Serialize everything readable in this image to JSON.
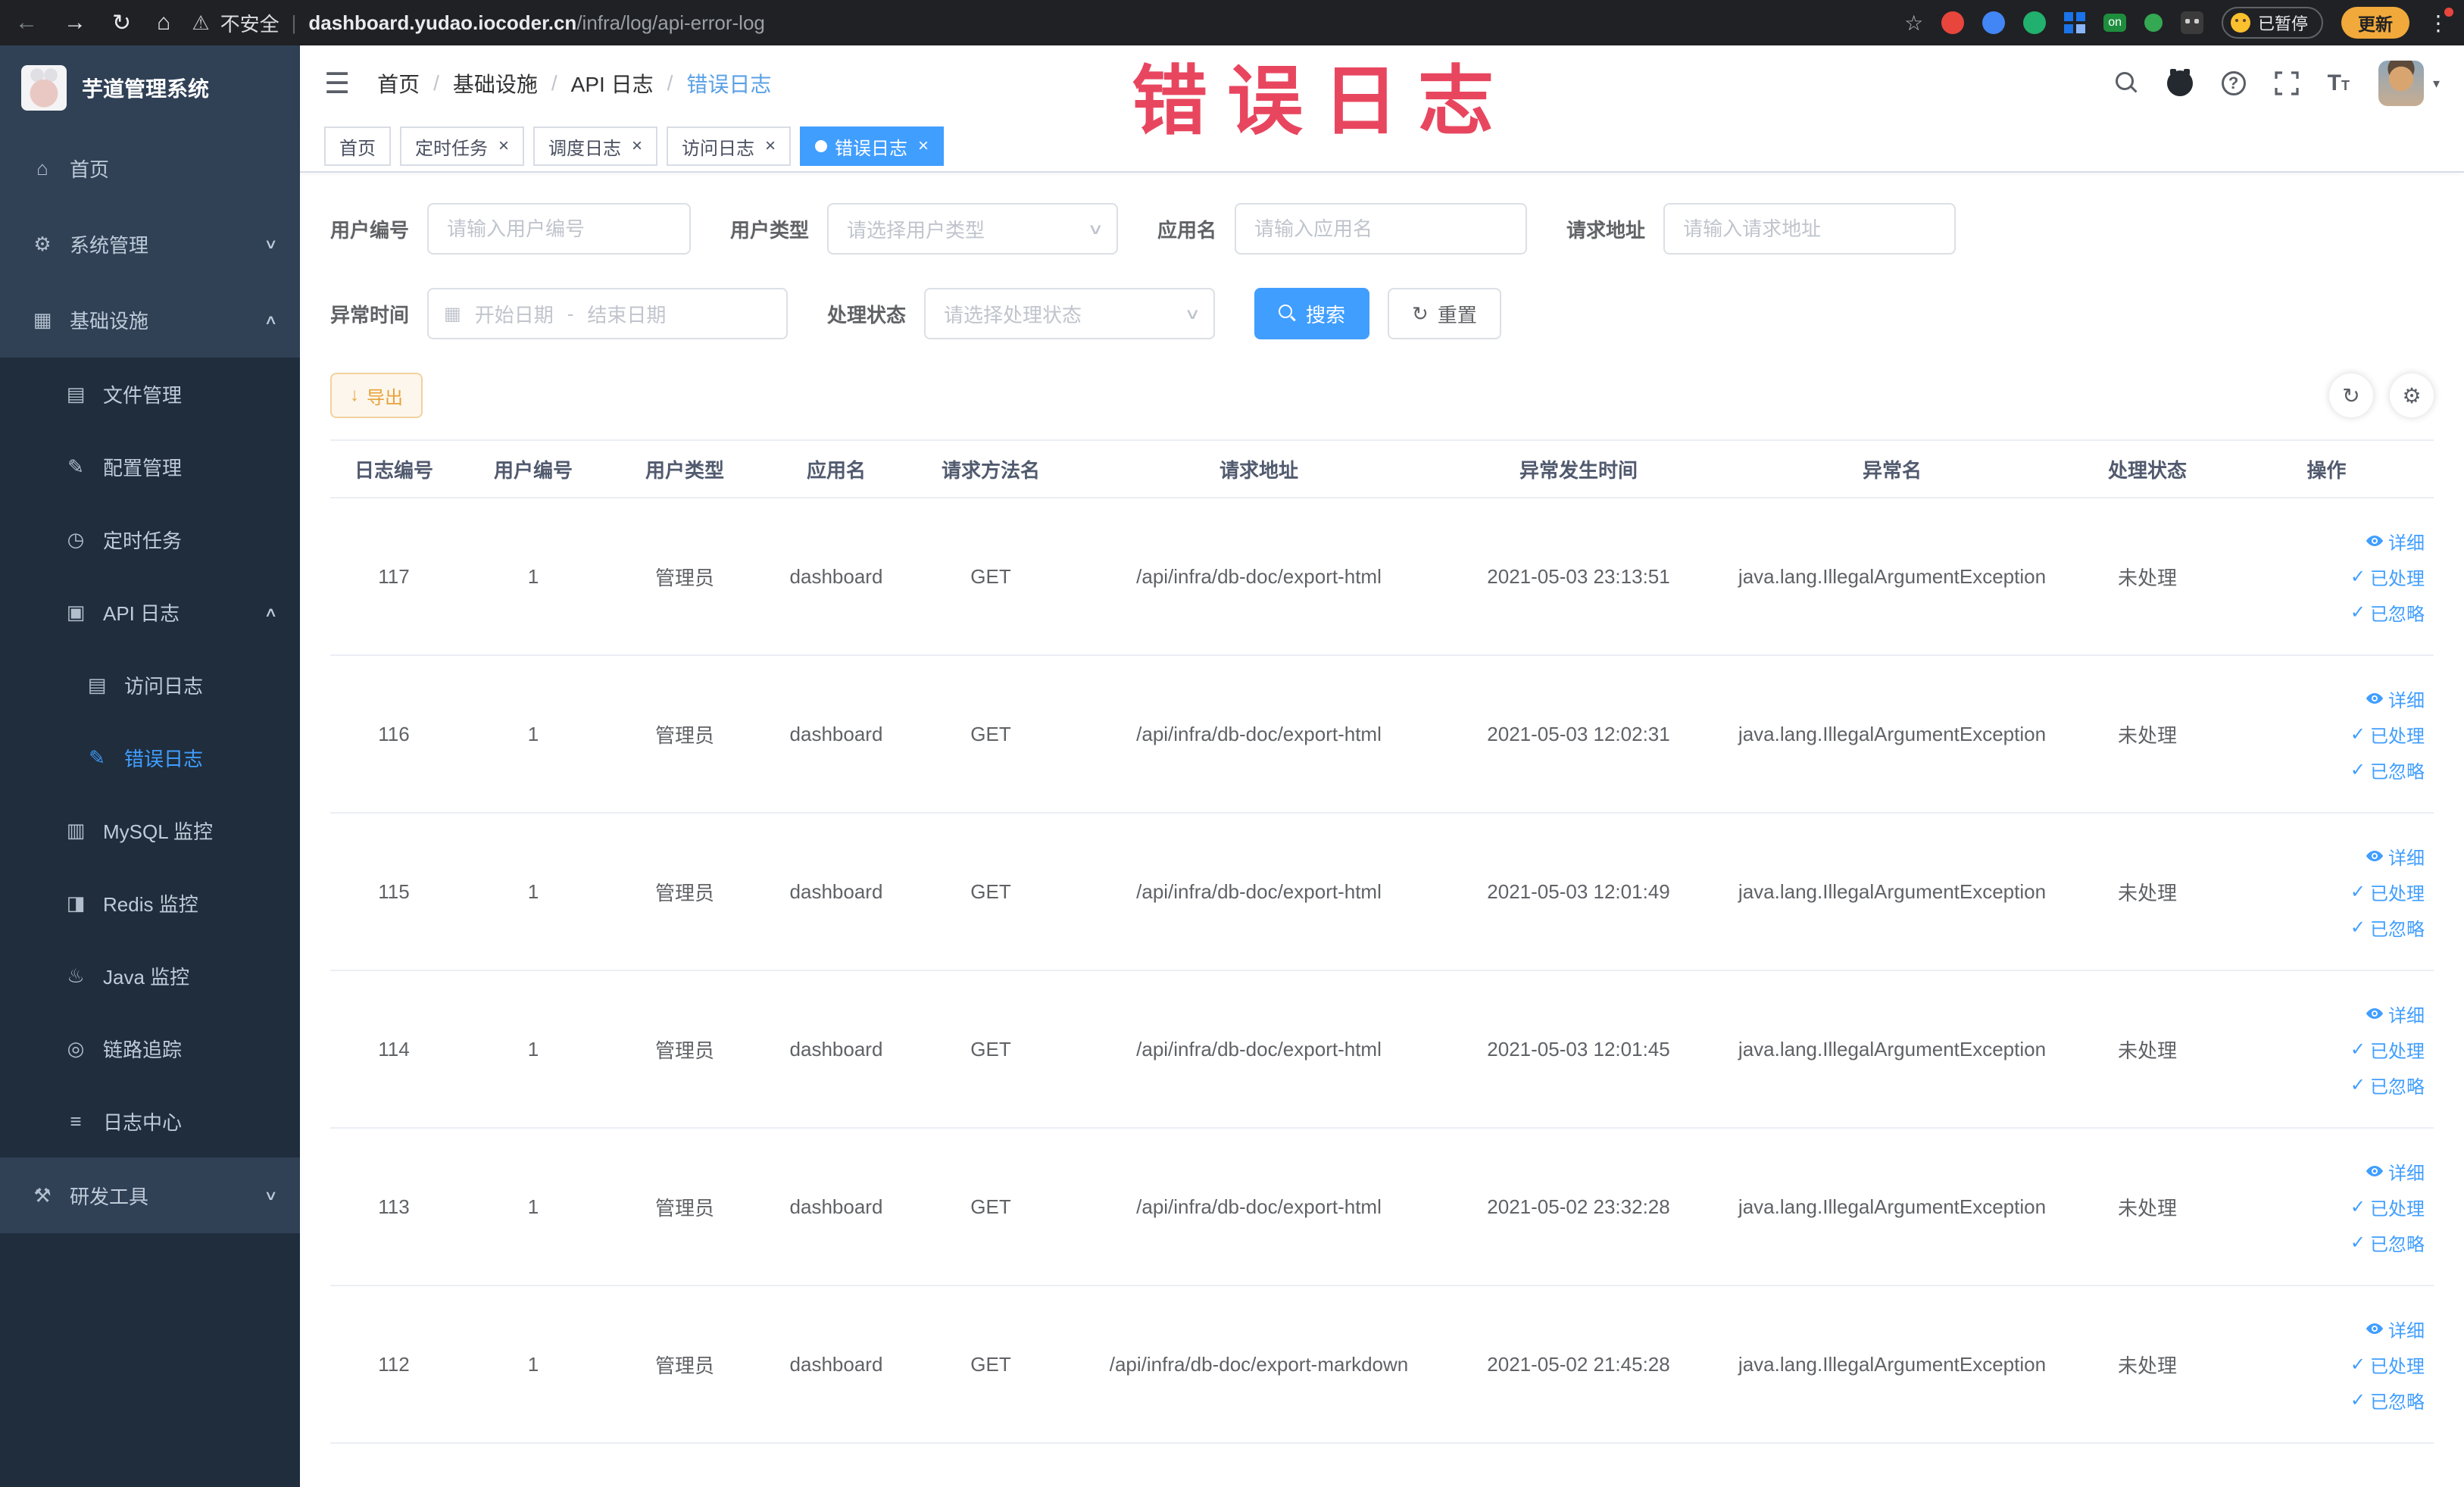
{
  "browser": {
    "security_warning": "不安全",
    "url_host": "dashboard.yudao.iocoder.cn",
    "url_path": "/infra/log/api-error-log",
    "on_badge": "on",
    "paused_badge": "已暂停",
    "update_button": "更新"
  },
  "watermark": "错误日志",
  "sidebar": {
    "logo_title": "芋道管理系统",
    "items": [
      {
        "label": "首页",
        "icon": "home-icon",
        "level": 0
      },
      {
        "label": "系统管理",
        "icon": "gear-icon",
        "level": 0,
        "arrow": "down"
      },
      {
        "label": "基础设施",
        "icon": "infra-icon",
        "level": 0,
        "arrow": "up"
      },
      {
        "label": "文件管理",
        "icon": "file-icon",
        "level": 1
      },
      {
        "label": "配置管理",
        "icon": "config-icon",
        "level": 1
      },
      {
        "label": "定时任务",
        "icon": "timer-icon",
        "level": 1
      },
      {
        "label": "API 日志",
        "icon": "api-log-icon",
        "level": 1,
        "arrow": "up"
      },
      {
        "label": "访问日志",
        "icon": "access-log-icon",
        "level": 2
      },
      {
        "label": "错误日志",
        "icon": "error-log-icon",
        "level": 2,
        "active": true
      },
      {
        "label": "MySQL 监控",
        "icon": "mysql-icon",
        "level": 1
      },
      {
        "label": "Redis 监控",
        "icon": "redis-icon",
        "level": 1
      },
      {
        "label": "Java 监控",
        "icon": "java-icon",
        "level": 1
      },
      {
        "label": "链路追踪",
        "icon": "trace-icon",
        "level": 1
      },
      {
        "label": "日志中心",
        "icon": "log-center-icon",
        "level": 1
      },
      {
        "label": "研发工具",
        "icon": "tools-icon",
        "level": 0,
        "arrow": "down"
      }
    ]
  },
  "breadcrumb": [
    "首页",
    "基础设施",
    "API 日志",
    "错误日志"
  ],
  "tabs": [
    {
      "label": "首页",
      "closable": false,
      "active": false
    },
    {
      "label": "定时任务",
      "closable": true,
      "active": false
    },
    {
      "label": "调度日志",
      "closable": true,
      "active": false
    },
    {
      "label": "访问日志",
      "closable": true,
      "active": false
    },
    {
      "label": "错误日志",
      "closable": true,
      "active": true
    }
  ],
  "search": {
    "fields": {
      "user_id": {
        "label": "用户编号",
        "placeholder": "请输入用户编号"
      },
      "user_type": {
        "label": "用户类型",
        "placeholder": "请选择用户类型"
      },
      "app_name": {
        "label": "应用名",
        "placeholder": "请输入应用名"
      },
      "request_url": {
        "label": "请求地址",
        "placeholder": "请输入请求地址"
      },
      "exception_time": {
        "label": "异常时间",
        "start_placeholder": "开始日期",
        "separator": "-",
        "end_placeholder": "结束日期"
      },
      "process_status": {
        "label": "处理状态",
        "placeholder": "请选择处理状态"
      }
    },
    "search_button": "搜索",
    "reset_button": "重置"
  },
  "toolbar": {
    "export_button": "导出"
  },
  "table": {
    "columns": [
      "日志编号",
      "用户编号",
      "用户类型",
      "应用名",
      "请求方法名",
      "请求地址",
      "异常发生时间",
      "异常名",
      "处理状态",
      "操作"
    ],
    "action_labels": [
      "详细",
      "已处理",
      "已忽略"
    ],
    "rows": [
      {
        "id": "117",
        "user_id": "1",
        "user_type": "管理员",
        "app": "dashboard",
        "method": "GET",
        "url": "/api/infra/db-doc/export-html",
        "time": "2021-05-03 23:13:51",
        "exception": "java.lang.IllegalArgumentException",
        "status": "未处理"
      },
      {
        "id": "116",
        "user_id": "1",
        "user_type": "管理员",
        "app": "dashboard",
        "method": "GET",
        "url": "/api/infra/db-doc/export-html",
        "time": "2021-05-03 12:02:31",
        "exception": "java.lang.IllegalArgumentException",
        "status": "未处理"
      },
      {
        "id": "115",
        "user_id": "1",
        "user_type": "管理员",
        "app": "dashboard",
        "method": "GET",
        "url": "/api/infra/db-doc/export-html",
        "time": "2021-05-03 12:01:49",
        "exception": "java.lang.IllegalArgumentException",
        "status": "未处理"
      },
      {
        "id": "114",
        "user_id": "1",
        "user_type": "管理员",
        "app": "dashboard",
        "method": "GET",
        "url": "/api/infra/db-doc/export-html",
        "time": "2021-05-03 12:01:45",
        "exception": "java.lang.IllegalArgumentException",
        "status": "未处理"
      },
      {
        "id": "113",
        "user_id": "1",
        "user_type": "管理员",
        "app": "dashboard",
        "method": "GET",
        "url": "/api/infra/db-doc/export-html",
        "time": "2021-05-02 23:32:28",
        "exception": "java.lang.IllegalArgumentException",
        "status": "未处理"
      },
      {
        "id": "112",
        "user_id": "1",
        "user_type": "管理员",
        "app": "dashboard",
        "method": "GET",
        "url": "/api/infra/db-doc/export-markdown",
        "time": "2021-05-02 21:45:28",
        "exception": "java.lang.IllegalArgumentException",
        "status": "未处理"
      }
    ]
  },
  "colors": {
    "primary": "#409eff",
    "sidebar_bg": "#304156",
    "submenu_bg": "#1f2d3d",
    "danger": "#e8465f",
    "warning": "#e6a23c"
  }
}
